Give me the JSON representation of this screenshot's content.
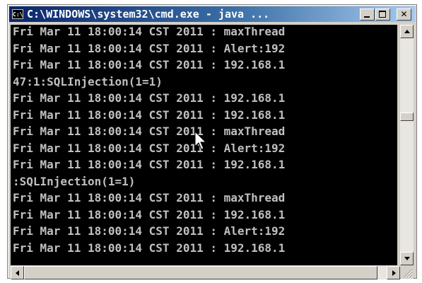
{
  "window": {
    "title": "C:\\WINDOWS\\system32\\cmd.exe - java ...",
    "icon_name": "cmd-icon",
    "icon_text": "C:\\",
    "buttons": [
      {
        "name": "minimize-button",
        "icon": "minimize-icon"
      },
      {
        "name": "maximize-button",
        "icon": "maximize-icon"
      },
      {
        "name": "close-button",
        "icon": "close-icon",
        "glyph": "✕"
      }
    ]
  },
  "console": {
    "text_color": "#c0c0c0",
    "background": "#000000",
    "lines": [
      "Fri Mar 11 18:00:14 CST 2011 : maxThread",
      "Fri Mar 11 18:00:14 CST 2011 : Alert:192",
      "Fri Mar 11 18:00:14 CST 2011 : 192.168.1",
      "47:1:SQLInjection(1=1)",
      "Fri Mar 11 18:00:14 CST 2011 : 192.168.1",
      "Fri Mar 11 18:00:14 CST 2011 : 192.168.1",
      "Fri Mar 11 18:00:14 CST 2011 : maxThread",
      "Fri Mar 11 18:00:14 CST 2011 : Alert:192",
      "Fri Mar 11 18:00:14 CST 2011 : 192.168.1",
      ":SQLInjection(1=1)",
      "Fri Mar 11 18:00:14 CST 2011 : maxThread",
      "Fri Mar 11 18:00:14 CST 2011 : 192.168.1",
      "Fri Mar 11 18:00:14 CST 2011 : Alert:192",
      "Fri Mar 11 18:00:14 CST 2011 : 192.168.1"
    ]
  },
  "scrollbars": {
    "vertical_position": 0.37,
    "horizontal_position": 0.0
  },
  "titlebar_gradient": [
    "#0a246a",
    "#a6caf0"
  ]
}
